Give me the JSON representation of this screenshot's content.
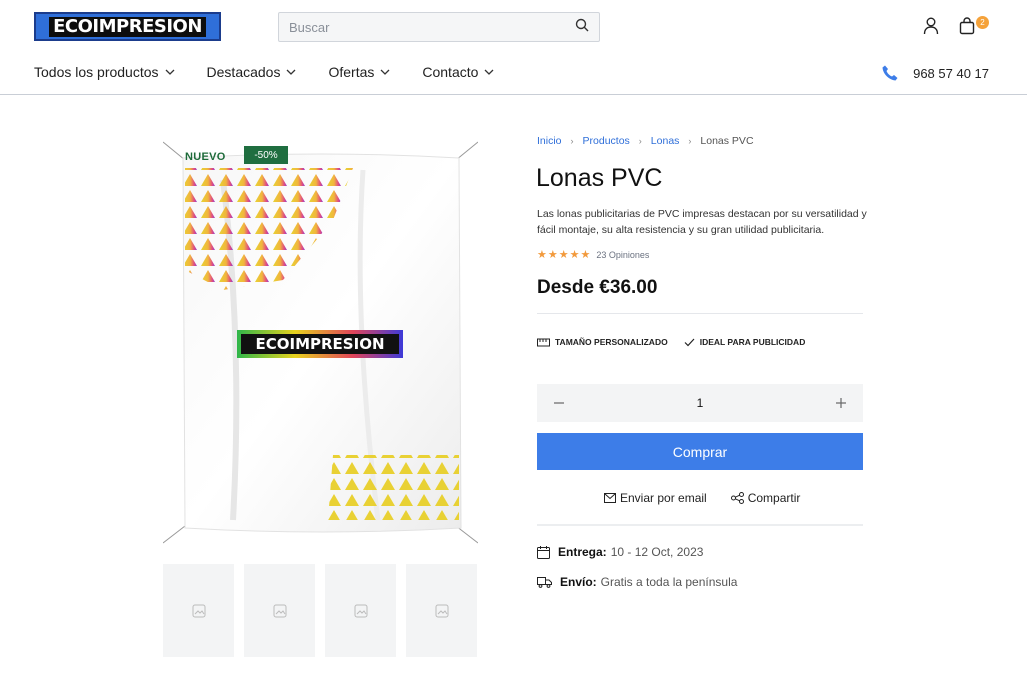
{
  "header": {
    "logo_text": "ECOIMPRESION",
    "search_placeholder": "Buscar",
    "cart_count": "2",
    "phone": "968 57 40 17"
  },
  "nav": {
    "items": [
      {
        "label": "Todos los productos"
      },
      {
        "label": "Destacados"
      },
      {
        "label": "Ofertas"
      },
      {
        "label": "Contacto"
      }
    ]
  },
  "product": {
    "badge_new": "NUEVO",
    "badge_discount": "-50%",
    "image_logo_text": "ECOIMPRESION",
    "breadcrumb": [
      "Inicio",
      "Productos",
      "Lonas",
      "Lonas PVC"
    ],
    "title": "Lonas PVC",
    "description": "Las lonas publicitarias de PVC impresas destacan por su versatilidad y fácil montaje, su alta resistencia y su gran utilidad publicitaria.",
    "stars": "★★★★★",
    "reviews": "23 Opiniones",
    "price": "Desde €36.00",
    "features": [
      "TAMAÑO PERSONALIZADO",
      "IDEAL PARA PUBLICIDAD"
    ],
    "quantity": "1",
    "buy_label": "Comprar",
    "email_label": "Enviar por email",
    "share_label": "Compartir",
    "delivery_label": "Entrega:",
    "delivery_value": "10 - 12 Oct, 2023",
    "shipping_label": "Envío:",
    "shipping_value": "Gratis a toda la península"
  },
  "colors": {
    "accent": "#3d7de8",
    "link": "#2f6fd9",
    "badge_green": "#1f6e40",
    "star": "#f29a3c"
  }
}
